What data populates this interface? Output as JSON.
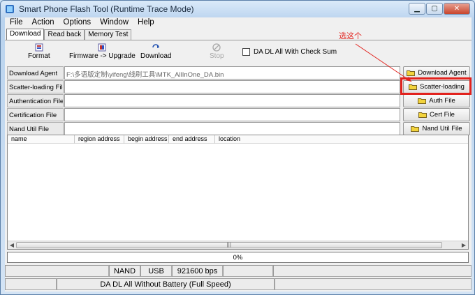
{
  "window": {
    "title": "Smart Phone Flash Tool (Runtime Trace Mode)",
    "controls": {
      "minimize": "▁",
      "maximize": "▢",
      "close": "✕"
    }
  },
  "menu": [
    "File",
    "Action",
    "Options",
    "Window",
    "Help"
  ],
  "tabs": [
    {
      "label": "Download",
      "active": true
    },
    {
      "label": "Read back",
      "active": false
    },
    {
      "label": "Memory Test",
      "active": false
    }
  ],
  "toolbar": {
    "format": {
      "label": "Format",
      "icon": "format-icon"
    },
    "firmware_upgrade": {
      "label": "Firmware -> Upgrade",
      "icon": "firmware-upgrade-icon"
    },
    "download": {
      "label": "Download",
      "icon": "download-icon"
    },
    "stop": {
      "label": "Stop",
      "icon": "stop-icon",
      "enabled": false
    },
    "checksum": {
      "label": "DA DL All With Check Sum",
      "checked": false
    }
  },
  "files": [
    {
      "label": "Download Agent",
      "value": "F:\\多语版定制\\yifeng\\线刷工具\\MTK_AllInOne_DA.bin",
      "button": "Download Agent"
    },
    {
      "label": "Scatter-loading File",
      "value": "",
      "button": "Scatter-loading"
    },
    {
      "label": "Authentication File",
      "value": "",
      "button": "Auth File"
    },
    {
      "label": "Certification File",
      "value": "",
      "button": "Cert File"
    },
    {
      "label": "Nand Util File",
      "value": "",
      "button": "Nand Util File"
    }
  ],
  "annotation": {
    "text": "选这个",
    "color": "#e2221d"
  },
  "table": {
    "columns": [
      "name",
      "region address",
      "begin address",
      "end address",
      "location"
    ],
    "rows": [],
    "scrollbar": {
      "left": "◀",
      "right": "▶",
      "grip": "|||"
    }
  },
  "progress": {
    "text": "0%",
    "value": 0
  },
  "status": {
    "storage": "NAND",
    "port": "USB",
    "baud": "921600 bps",
    "mode": "DA DL All Without Battery (Full Speed)"
  },
  "colors": {
    "accent_red": "#e2221d",
    "folder_yellow": "#f2d33c"
  }
}
